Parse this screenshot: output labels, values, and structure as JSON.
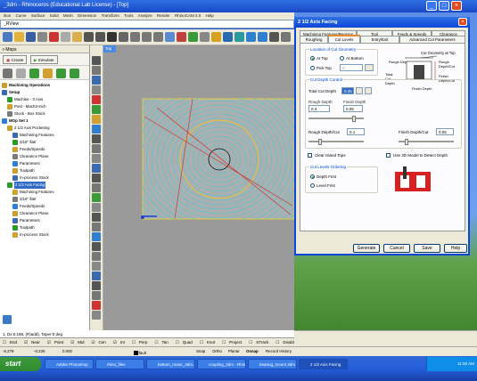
{
  "window": {
    "title": "_3dm - Rhinoceros (Educational Lab License) - [Top]",
    "menu": [
      "ition",
      "Curve",
      "Surface",
      "Solid",
      "Mesh",
      "Dimension",
      "Transform",
      "Tools",
      "Analyze",
      "Render",
      "RhinoCAM 2.0",
      "Help"
    ]
  },
  "command": {
    "prompt": "_RView",
    "history": "1, Dx:0.188, (R)add), Taper:0 deg"
  },
  "mops_panel": {
    "header": "r-Mops",
    "create_label": "Create",
    "simulate_label": "Simulate",
    "tree_items": [
      {
        "label": "Machining Operations",
        "level": 0
      },
      {
        "label": "Setup",
        "level": 0
      },
      {
        "label": "Machine - 3 Axis",
        "level": 1
      },
      {
        "label": "Post - Mach3-Inch",
        "level": 1
      },
      {
        "label": "Stock - Box Stock",
        "level": 1
      },
      {
        "label": "MOp Set 1",
        "level": 0
      },
      {
        "label": "2 1/2 Axis Pocketing",
        "level": 1
      },
      {
        "label": "Machining Features",
        "level": 2
      },
      {
        "label": "3/16\" flat/",
        "level": 2
      },
      {
        "label": "Feeds/Speeds",
        "level": 2
      },
      {
        "label": "Clearance Plane",
        "level": 2
      },
      {
        "label": "Parameters",
        "level": 2
      },
      {
        "label": "Toolpath",
        "level": 2
      },
      {
        "label": "In-process Stock",
        "level": 2
      },
      {
        "label": "2 1/2 Axis Facing",
        "level": 1,
        "selected": true
      },
      {
        "label": "Machining Features",
        "level": 2
      },
      {
        "label": "3/16\" flat/",
        "level": 2
      },
      {
        "label": "Feeds/Speeds",
        "level": 2
      },
      {
        "label": "Clearance Plane",
        "level": 2
      },
      {
        "label": "Parameters",
        "level": 2
      },
      {
        "label": "Toolpath",
        "level": 2
      },
      {
        "label": "In-process Stock",
        "level": 2
      }
    ]
  },
  "viewport": {
    "label": "Top"
  },
  "osnaps": [
    "End",
    "Near",
    "Point",
    "Mid",
    "Cen",
    "Int",
    "Perp",
    "Tan",
    "Quad",
    "Knot",
    "Project",
    "STrack",
    "Disable"
  ],
  "status": {
    "x": "-6.279",
    "y": "-0.226",
    "z": "0.000",
    "layer": "Default",
    "items": [
      "Snap",
      "Ortho",
      "Planar",
      "Osnap",
      "Record History"
    ]
  },
  "dialog": {
    "title": "2 1/2 Axis Facing",
    "tabs_row1": [
      "Machining Features/Regions",
      "Tool",
      "Feeds & Speeds",
      "Clearance"
    ],
    "tabs_row2": [
      "Roughing",
      "Cut Levels",
      "Entry/Exit",
      "Advanced Cut Parameters"
    ],
    "location_group": "Location of Cut Geometry",
    "at_top": "At Top",
    "at_bottom": "At Bottom",
    "pick_top": "Pick Top",
    "pick_top_value": "0",
    "diagram_title": "Cut Geometry at Top",
    "diagram_labels": [
      "Rough Depth",
      "Rough Depth/Cut",
      "Total Cut Depth",
      "Finish Depth/Cut",
      "Finish Depth"
    ],
    "depth_group": "Cut Depth Control",
    "total_cut_depth_label": "Total Cut Depth",
    "total_cut_depth": "0.45",
    "rough_depth_label": "Rough Depth",
    "rough_depth": "0.4",
    "finish_depth_label": "Finish Depth",
    "finish_depth": "0.05",
    "rough_depth_cut_label": "Rough Depth/Cut",
    "rough_depth_cut": "0.1",
    "finish_depth_cut_label": "Finish Depth/Cut",
    "finish_depth_cut": "0.05",
    "clear_island": "Clear Island Tops",
    "use_3d_model": "Use 3D Model to Detect Depth",
    "ordering_group": "Cut Levels Ordering",
    "depth_first": "Depth First",
    "level_first": "Level First",
    "buttons": [
      "Generate",
      "Cancel",
      "Save",
      "Help"
    ]
  },
  "taskbar": {
    "start": "start",
    "tasks": [
      "Adobe Photoshop",
      "rhino_files",
      "bottom_motor_3dm...",
      "coupling_3dm - Rhino...",
      "bearing_mount 3dm - ...",
      "2 1/2 Axis Facing"
    ],
    "clock": "11:00 AM"
  }
}
